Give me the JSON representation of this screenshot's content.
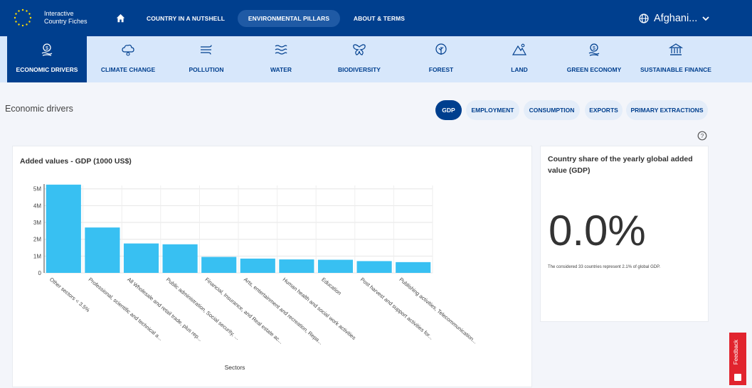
{
  "header": {
    "logo_text_line1": "Interactive",
    "logo_text_line2": "Country Fiches",
    "nav": [
      {
        "label": "COUNTRY IN A NUTSHELL"
      },
      {
        "label": "ENVIRONMENTAL PILLARS",
        "active": true
      },
      {
        "label": "ABOUT & TERMS"
      }
    ],
    "country": "Afghani..."
  },
  "pillars": [
    {
      "label": "ECONOMIC DRIVERS",
      "icon": "economy-icon",
      "active": true
    },
    {
      "label": "CLIMATE CHANGE",
      "icon": "climate-icon"
    },
    {
      "label": "POLLUTION",
      "icon": "pollution-icon"
    },
    {
      "label": "WATER",
      "icon": "water-icon"
    },
    {
      "label": "BIODIVERSITY",
      "icon": "butterfly-icon"
    },
    {
      "label": "FOREST",
      "icon": "tree-icon"
    },
    {
      "label": "LAND",
      "icon": "mountain-icon"
    },
    {
      "label": "GREEN ECONOMY",
      "icon": "green-economy-icon"
    },
    {
      "label": "SUSTAINABLE FINANCE",
      "icon": "bank-icon"
    }
  ],
  "section_title": "Economic drivers",
  "indicators": [
    {
      "label": "GDP",
      "active": true
    },
    {
      "label": "EMPLOYMENT"
    },
    {
      "label": "CONSUMPTION"
    },
    {
      "label": "EXPORTS"
    },
    {
      "label": "PRIMARY EXTRACTIONS"
    }
  ],
  "share_card": {
    "title": "Country share of the yearly global added value (GDP)",
    "value": "0.0%",
    "note": "The considered 33 countries represent 2.1% of global GDP."
  },
  "feedback_label": "Feedback",
  "colors": {
    "brand": "#003f8e",
    "bar": "#38c0f2",
    "subnav": "#d7e7fb",
    "feedback": "#e1242e"
  },
  "chart_data": {
    "type": "bar",
    "title": "Added values - GDP (1000 US$)",
    "xlabel": "Sectors",
    "ylabel": "",
    "ylim": [
      0,
      5200000
    ],
    "yticks": [
      0,
      1000000,
      2000000,
      3000000,
      4000000,
      5000000
    ],
    "ytick_labels": [
      "0",
      "1M",
      "2M",
      "3M",
      "4M",
      "5M"
    ],
    "grid": true,
    "categories": [
      "Other sectors < 3.5%",
      "Professional, scientific and technical a...",
      "All Wholesale and retail trade, plus rep...",
      "Public administration, Social security, ...",
      "Financial, Insurance, and Real estate ac...",
      "Arts, entertainment and recreation, Repa...",
      "Human health and social work activities",
      "Education",
      "Post harvest and support activities for...",
      "Publishing activities, Telecommunication..."
    ],
    "values": [
      5250000,
      2700000,
      1750000,
      1700000,
      950000,
      850000,
      800000,
      780000,
      700000,
      640000
    ]
  }
}
